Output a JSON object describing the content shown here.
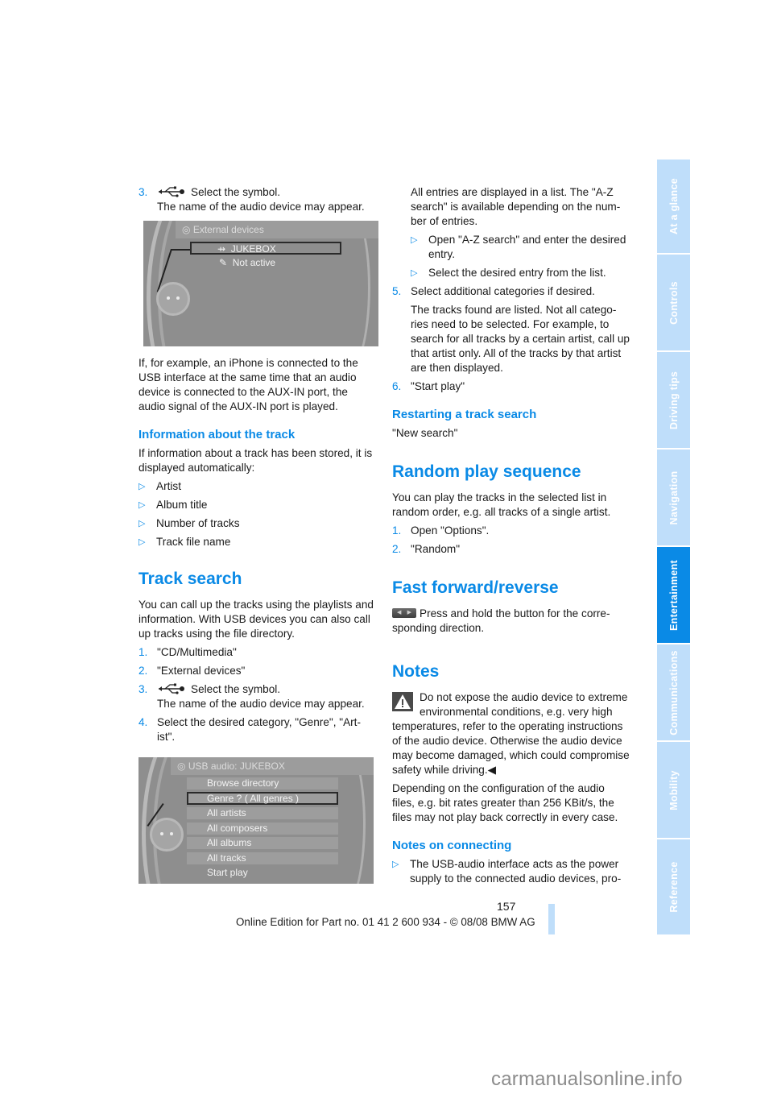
{
  "colors": {
    "accent": "#0a8ae6",
    "tab_inactive": "#bfdefa",
    "tab_active": "#0a8ae6"
  },
  "left": {
    "step3_top": {
      "num": "3.",
      "icon": "usb-icon",
      "text": "Select the symbol.",
      "sub": "The name of the audio device may appear."
    },
    "screen1": {
      "title": "External devices",
      "items": [
        {
          "icon": "usb-icon",
          "label": "JUKEBOX",
          "selected": true
        },
        {
          "icon": "plug-icon",
          "label": "Not active",
          "selected": false
        }
      ]
    },
    "iphone_para": "If, for example, an iPhone is connected to the USB interface at the same time that an audio device is connected to the AUX-IN port, the audio signal of the AUX-IN port is played.",
    "info_heading": "Information about the track",
    "info_para": "If information about a track has been stored, it is displayed automatically:",
    "info_bullets": [
      "Artist",
      "Album title",
      "Number of tracks",
      "Track file name"
    ],
    "track_search_heading": "Track search",
    "track_search_para": "You can call up the tracks using the playlists and information. With USB devices you can also call up tracks using the file directory.",
    "steps": [
      {
        "num": "1.",
        "text": "\"CD/Multimedia\""
      },
      {
        "num": "2.",
        "text": "\"External devices\""
      },
      {
        "num": "3.",
        "text": "Select the symbol.",
        "sub": "The name of the audio device may appear."
      },
      {
        "num": "4.",
        "text": "Select the desired category, \"Genre\", \"Art-ist\"."
      }
    ],
    "screen2": {
      "title": "USB audio: JUKEBOX",
      "items": [
        {
          "label": "Browse directory",
          "selected": false
        },
        {
          "label": "Genre ? ( All genres )",
          "selected": true
        },
        {
          "label": "All artists",
          "selected": false
        },
        {
          "label": "All composers",
          "selected": false
        },
        {
          "label": "All albums",
          "selected": false
        },
        {
          "label": "All tracks",
          "selected": false
        },
        {
          "label": "Start play",
          "selected": false
        }
      ]
    }
  },
  "right": {
    "list_para": "All entries are displayed in a list. The \"A-Z search\" is available depending on the num-ber of entries.",
    "list_bullets": [
      "Open \"A-Z search\" and enter the desired entry.",
      "Select the desired entry from the list."
    ],
    "step5": {
      "num": "5.",
      "text": "Select additional categories if desired."
    },
    "step5_para": "The tracks found are listed. Not all catego-ries need to be selected. For example, to search for all tracks by a certain artist, call up that artist only. All of the tracks by that artist are then displayed.",
    "step6": {
      "num": "6.",
      "text": "\"Start play\""
    },
    "restart_heading": "Restarting a track search",
    "restart_text": "\"New search\"",
    "random_heading": "Random play sequence",
    "random_para": "You can play the tracks in the selected list in random order, e.g. all tracks of a single artist.",
    "random_steps": [
      {
        "num": "1.",
        "text": "Open \"Options\"."
      },
      {
        "num": "2.",
        "text": "\"Random\""
      }
    ],
    "ff_heading": "Fast forward/reverse",
    "ff_text": "Press and hold the button for the corre-sponding direction.",
    "notes_heading": "Notes",
    "warning_text": "Do not expose the audio device to extreme environmental conditions, e.g. very high temperatures, refer to the operating instructions of the audio device. Otherwise the audio device may become damaged, which could compromise safety while driving.",
    "warning_end": "◀",
    "bitrate_para": "Depending on the configuration of the audio files, e.g. bit rates greater than 256 KBit/s, the files may not play back correctly in every case.",
    "connecting_heading": "Notes on connecting",
    "connecting_bullets": [
      "The USB-audio interface acts as the power supply to the connected audio devices, pro-"
    ]
  },
  "sidebar": {
    "tabs": [
      {
        "label": "At a glance",
        "active": false
      },
      {
        "label": "Controls",
        "active": false
      },
      {
        "label": "Driving tips",
        "active": false
      },
      {
        "label": "Navigation",
        "active": false
      },
      {
        "label": "Entertainment",
        "active": true
      },
      {
        "label": "Communications",
        "active": false
      },
      {
        "label": "Mobility",
        "active": false
      },
      {
        "label": "Reference",
        "active": false
      }
    ]
  },
  "footer": {
    "page_number": "157",
    "edition": "Online Edition for Part no. 01 41 2 600 934 - © 08/08 BMW AG"
  },
  "watermark": "carmanualsonline.info"
}
